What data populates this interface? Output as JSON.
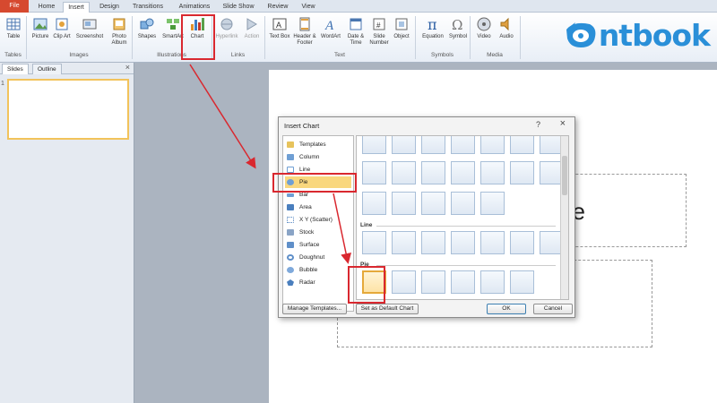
{
  "tabs": [
    "File",
    "Home",
    "Insert",
    "Design",
    "Transitions",
    "Animations",
    "Slide Show",
    "Review",
    "View"
  ],
  "ribbon": {
    "buttons": [
      {
        "label": "Table",
        "icon": "table-icon"
      },
      {
        "label": "Picture",
        "icon": "picture-icon"
      },
      {
        "label": "Clip Art",
        "icon": "clip-art-icon"
      },
      {
        "label": "Screenshot",
        "icon": "screenshot-icon"
      },
      {
        "label": "Photo Album",
        "icon": "photo-album-icon"
      },
      {
        "label": "Shapes",
        "icon": "shapes-icon"
      },
      {
        "label": "SmartArt",
        "icon": "smartart-icon"
      },
      {
        "label": "Chart",
        "icon": "chart-icon"
      },
      {
        "label": "Hyperlink",
        "icon": "hyperlink-icon"
      },
      {
        "label": "Action",
        "icon": "action-icon"
      },
      {
        "label": "Text Box",
        "icon": "text-box-icon"
      },
      {
        "label": "Header & Footer",
        "icon": "header-footer-icon"
      },
      {
        "label": "WordArt",
        "icon": "wordart-icon"
      },
      {
        "label": "Date & Time",
        "icon": "date-time-icon"
      },
      {
        "label": "Slide Number",
        "icon": "slide-number-icon"
      },
      {
        "label": "Object",
        "icon": "object-icon"
      },
      {
        "label": "Equation",
        "icon": "equation-icon"
      },
      {
        "label": "Symbol",
        "icon": "symbol-icon"
      },
      {
        "label": "Video",
        "icon": "video-icon"
      },
      {
        "label": "Audio",
        "icon": "audio-icon"
      }
    ],
    "groups": [
      "Tables",
      "Images",
      "Illustrations",
      "Links",
      "Text",
      "Symbols",
      "Media"
    ]
  },
  "logo": {
    "text": "ntbook",
    "color": "#2a8fd8"
  },
  "left_panel": {
    "tabs": [
      "Slides",
      "Outline"
    ],
    "close": "×",
    "slide_number": "1"
  },
  "slide": {
    "title_fragment": "e"
  },
  "dialog": {
    "title": "Insert Chart",
    "help": "?",
    "close": "×",
    "categories": [
      "Templates",
      "Column",
      "Line",
      "Pie",
      "Bar",
      "Area",
      "X Y (Scatter)",
      "Stock",
      "Surface",
      "Doughnut",
      "Bubble",
      "Radar"
    ],
    "selected_category": "Pie",
    "sections": [
      "Line",
      "Pie"
    ],
    "manage_templates": "Manage Templates...",
    "set_default": "Set as Default Chart",
    "ok": "OK",
    "cancel": "Cancel"
  },
  "accent_red": "#d9282f",
  "selection_color": "#f9d77e"
}
